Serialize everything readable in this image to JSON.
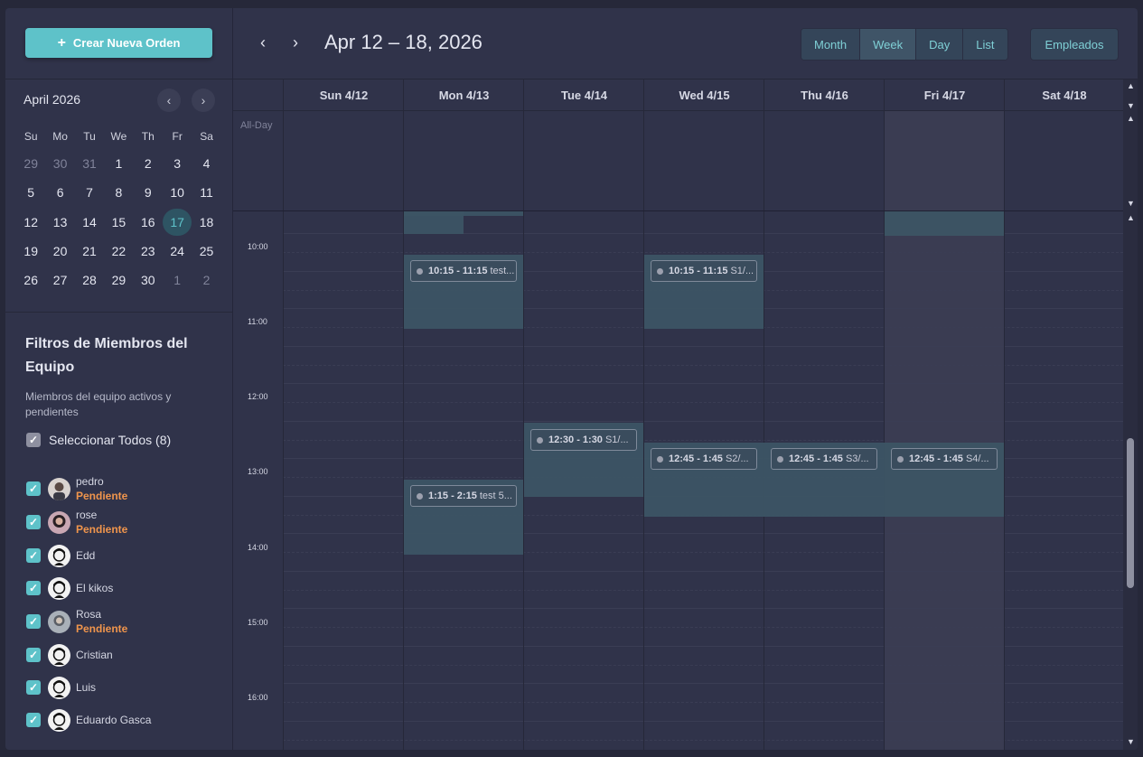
{
  "sidebar": {
    "create_button": "Crear Nueva Orden",
    "mini_calendar": {
      "title": "April 2026",
      "weekdays": [
        "Su",
        "Mo",
        "Tu",
        "We",
        "Th",
        "Fr",
        "Sa"
      ],
      "weeks": [
        [
          "29",
          "30",
          "31",
          "1",
          "2",
          "3",
          "4"
        ],
        [
          "5",
          "6",
          "7",
          "8",
          "9",
          "10",
          "11"
        ],
        [
          "12",
          "13",
          "14",
          "15",
          "16",
          "17",
          "18"
        ],
        [
          "19",
          "20",
          "21",
          "22",
          "23",
          "24",
          "25"
        ],
        [
          "26",
          "27",
          "28",
          "29",
          "30",
          "1",
          "2"
        ]
      ],
      "today": "17"
    },
    "filters": {
      "title": "Filtros de Miembros del Equipo",
      "subtitle": "Miembros del equipo activos y pendientes",
      "select_all": "Seleccionar Todos (8)",
      "members": [
        {
          "name": "pedro",
          "status": "Pendiente"
        },
        {
          "name": "rose",
          "status": "Pendiente"
        },
        {
          "name": "Edd",
          "status": ""
        },
        {
          "name": "El kikos",
          "status": ""
        },
        {
          "name": "Rosa",
          "status": "Pendiente"
        },
        {
          "name": "Cristian",
          "status": ""
        },
        {
          "name": "Luis",
          "status": ""
        },
        {
          "name": "Eduardo Gasca",
          "status": ""
        }
      ]
    }
  },
  "header": {
    "range_title": "Apr 12 – 18, 2026",
    "views": [
      "Month",
      "Week",
      "Day",
      "List"
    ],
    "active_view": "Week",
    "employees_button": "Empleados"
  },
  "calendar": {
    "days": [
      "Sun 4/12",
      "Mon 4/13",
      "Tue 4/14",
      "Wed 4/15",
      "Thu 4/16",
      "Fri 4/17",
      "Sat 4/18"
    ],
    "all_day_label": "All-Day",
    "hours": [
      "10:00",
      "11:00",
      "12:00",
      "13:00",
      "14:00",
      "15:00",
      "16:00"
    ],
    "events": [
      {
        "time": "10:15 - 11:15",
        "title": "test..."
      },
      {
        "time": "10:15 - 11:15",
        "title": "S1/..."
      },
      {
        "time": "12:30 - 1:30",
        "title": "S1/..."
      },
      {
        "time": "12:45 - 1:45",
        "title": "S2/..."
      },
      {
        "time": "12:45 - 1:45",
        "title": "S3/..."
      },
      {
        "time": "12:45 - 1:45",
        "title": "S4/..."
      },
      {
        "time": "1:15 - 2:15",
        "title": "test 5..."
      }
    ]
  }
}
